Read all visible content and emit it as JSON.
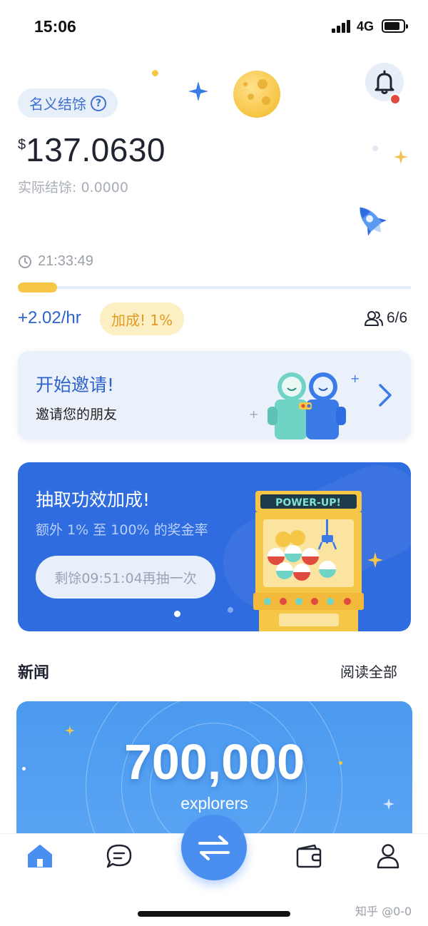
{
  "status_bar": {
    "time": "15:06",
    "network": "4G"
  },
  "header": {
    "nominal_label": "名义结馀",
    "help_glyph": "?",
    "currency_symbol": "$",
    "balance": "137.0630",
    "actual_balance": "实际结馀: 0.0000"
  },
  "mining": {
    "timer": "21:33:49",
    "progress_fraction": 0.1,
    "rate": "+2.02/hr",
    "bonus": "加成! 1%",
    "team_count": "6/6"
  },
  "invite_card": {
    "title": "开始邀请!",
    "subtitle": "邀请您的朋友"
  },
  "draw_card": {
    "title": "抽取功效加成!",
    "subtitle": "额外 1% 至 100% 的奖金率",
    "button": "剩馀09:51:04再抽一次",
    "machine_sign": "POWER-UP!"
  },
  "news": {
    "section_title": "新闻",
    "read_all": "阅读全部",
    "card_big": "700,000",
    "card_small": "explorers"
  },
  "tab_bar": {
    "items": [
      "home-icon",
      "chat-icon",
      "swap-icon",
      "wallet-icon",
      "profile-icon"
    ]
  },
  "watermark": "知乎 @0-0",
  "colors": {
    "accent": "#2c63cc",
    "bonus": "#e39a22",
    "card_blue": "#2f6cdf",
    "news_blue": "#4b9af0",
    "notification": "#e04b3f"
  }
}
